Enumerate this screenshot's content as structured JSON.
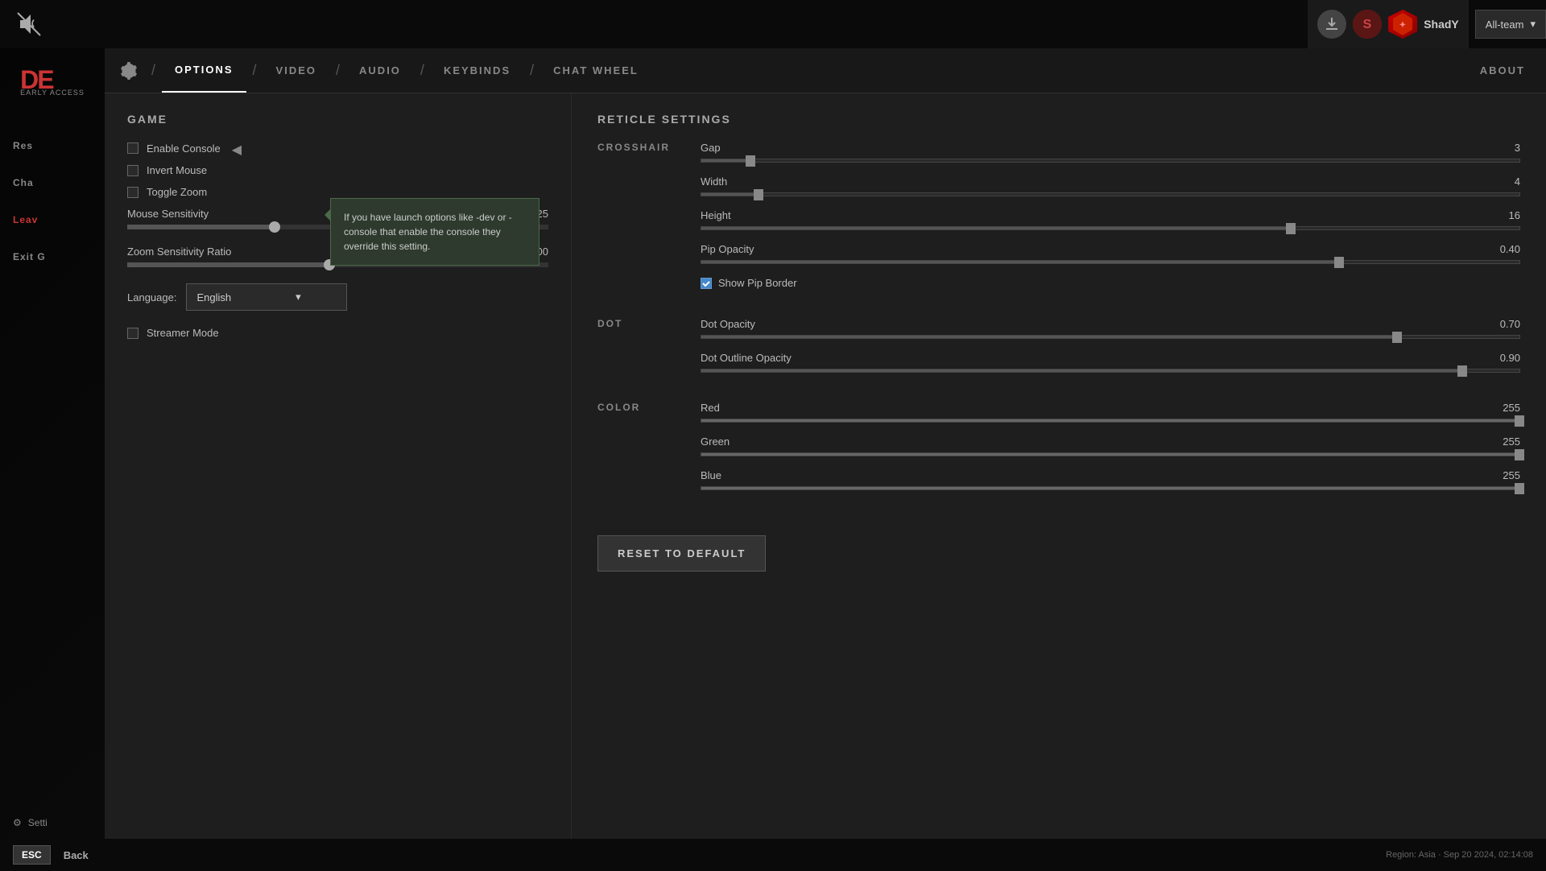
{
  "topbar": {
    "download_icon": "↓",
    "user_avatar_alt": "user avatar",
    "username": "ShadY",
    "team_selector": "All-team",
    "chevron": "▾"
  },
  "sidebar": {
    "logo_text": "DE",
    "subtitle": "EARLY ACCESS",
    "menu_items": [
      {
        "id": "resume",
        "label": "Res"
      },
      {
        "id": "chat",
        "label": "Cha"
      },
      {
        "id": "leave",
        "label": "Leav"
      },
      {
        "id": "exit",
        "label": "Exit G"
      }
    ],
    "settings_label": "Setti",
    "mute_icon": "🔇"
  },
  "nav": {
    "tabs": [
      {
        "id": "options",
        "label": "OPTIONS",
        "active": true
      },
      {
        "id": "video",
        "label": "VIDEO",
        "active": false
      },
      {
        "id": "audio",
        "label": "AUDIO",
        "active": false
      },
      {
        "id": "keybinds",
        "label": "KEYBINDS",
        "active": false
      },
      {
        "id": "chat_wheel",
        "label": "CHAT WHEEL",
        "active": false
      }
    ],
    "about_label": "ABOUT"
  },
  "game_section": {
    "title": "GAME",
    "enable_console_label": "Enable Console",
    "invert_mouse_label": "Invert Mouse",
    "toggle_zoom_label": "Toggle Zoom",
    "mouse_sensitivity_label": "Mouse Sensitivity",
    "mouse_sensitivity_value": "1.25",
    "mouse_sensitivity_pct": 35,
    "zoom_sensitivity_label": "Zoom Sensitivity Ratio",
    "zoom_sensitivity_value": "1.00",
    "zoom_sensitivity_pct": 48,
    "language_label": "Language:",
    "language_value": "English",
    "streamer_mode_label": "Streamer Mode"
  },
  "tooltip": {
    "text": "If you have launch options like -dev or -console that enable the console they override this setting."
  },
  "reticle_section": {
    "title": "RETICLE SETTINGS",
    "crosshair_label": "CROSSHAIR",
    "gap_label": "Gap",
    "gap_value": "3",
    "gap_pct": 6,
    "width_label": "Width",
    "width_value": "4",
    "width_pct": 7,
    "height_label": "Height",
    "height_value": "16",
    "height_pct": 72,
    "pip_opacity_label": "Pip Opacity",
    "pip_opacity_value": "0.40",
    "pip_opacity_pct": 78,
    "show_pip_border_label": "Show Pip Border",
    "show_pip_border_checked": true,
    "dot_label": "DOT",
    "dot_opacity_label": "Dot Opacity",
    "dot_opacity_value": "0.70",
    "dot_opacity_pct": 85,
    "dot_outline_opacity_label": "Dot Outline Opacity",
    "dot_outline_opacity_value": "0.90",
    "dot_outline_opacity_pct": 93,
    "color_label": "COLOR",
    "red_label": "Red",
    "red_value": "255",
    "red_pct": 100,
    "green_label": "Green",
    "green_value": "255",
    "green_pct": 100,
    "blue_label": "Blue",
    "blue_value": "255",
    "blue_pct": 100,
    "reset_button_label": "RESET TO DEFAULT"
  },
  "bottom": {
    "esc_label": "ESC",
    "back_label": "Back",
    "region_label": "Region: Asia",
    "datetime_label": "Sep 20 2024, 02:14:08"
  }
}
